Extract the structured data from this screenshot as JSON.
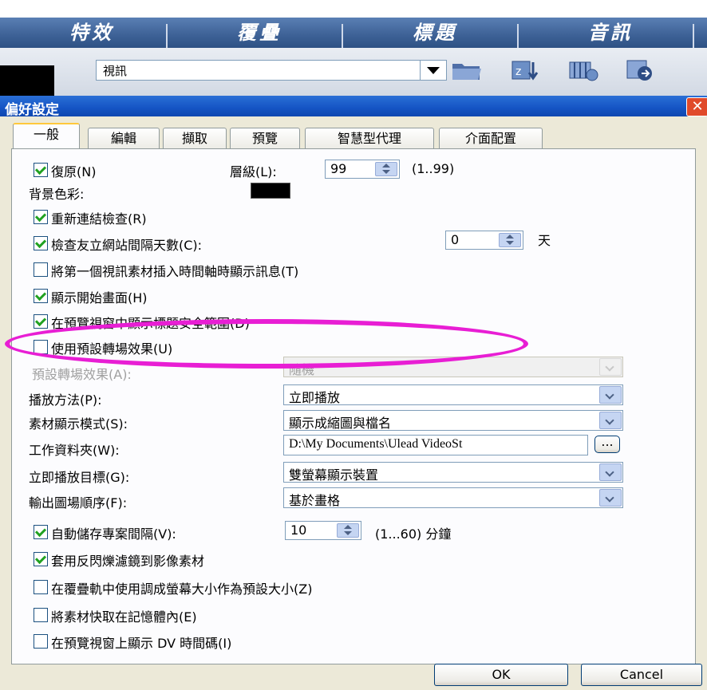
{
  "top_tabs": [
    "特效",
    "覆疊",
    "標題",
    "音訊"
  ],
  "toolbar": {
    "combo_value": "視訊",
    "icons": [
      "folder-icon",
      "sort-icon",
      "storyboard-icon",
      "media-rotate-icon"
    ]
  },
  "dialog": {
    "title": "偏好設定",
    "close_glyph": "✕"
  },
  "tabs": [
    "一般",
    "編輯",
    "擷取",
    "預覽",
    "智慧型代理",
    "介面配置"
  ],
  "general": {
    "undo_label": "復原(N)",
    "undo_checked": true,
    "level_label": "層級(L):",
    "level_value": "99",
    "level_range": "(1..99)",
    "bg_color_label": "背景色彩:",
    "bg_color": "#000000",
    "relink_label": "重新連結檢查(R)",
    "relink_checked": true,
    "check_site_label": "檢查友立網站間隔天數(C):",
    "check_site_checked": true,
    "check_site_value": "0",
    "check_site_unit": "天",
    "show_msg_label": "將第一個視訊素材插入時間軸時顯示訊息(T)",
    "show_msg_checked": false,
    "show_splash_label": "顯示開始畫面(H)",
    "show_splash_checked": true,
    "title_safe_label": "在預覽視窗中顯示標題安全範圍(D)",
    "title_safe_checked": true,
    "default_transition_label": "使用預設轉場效果(U)",
    "default_transition_checked": false,
    "default_transition_effect_label": "預設轉場效果(A):",
    "default_transition_effect_value": "隨機",
    "playback_label": "播放方法(P):",
    "playback_value": "立即播放",
    "clip_display_label": "素材顯示模式(S):",
    "clip_display_value": "顯示成縮圖與檔名",
    "work_folder_label": "工作資料夾(W):",
    "work_folder_value": "D:\\My Documents\\Ulead VideoSt",
    "browse_label": "...",
    "instant_target_label": "立即播放目標(G):",
    "instant_target_value": "雙螢幕顯示裝置",
    "field_order_label": "輸出圖場順序(F):",
    "field_order_value": "基於畫格",
    "autosave_label": "自動儲存專案間隔(V):",
    "autosave_checked": true,
    "autosave_value": "10",
    "autosave_range": "(1...60) 分鐘",
    "antiflicker_label": "套用反閃爍濾鏡到影像素材",
    "antiflicker_checked": true,
    "overlay_resize_label": "在覆疊軌中使用調成螢幕大小作為預設大小(Z)",
    "overlay_resize_checked": false,
    "cache_label": "將素材快取在記憶體內(E)",
    "cache_checked": false,
    "dv_timecode_label": "在預覽視窗上顯示 DV 時間碼(I)",
    "dv_timecode_checked": false
  },
  "buttons": {
    "ok": "OK",
    "cancel": "Cancel"
  },
  "annotation_color": "#e81ed4"
}
